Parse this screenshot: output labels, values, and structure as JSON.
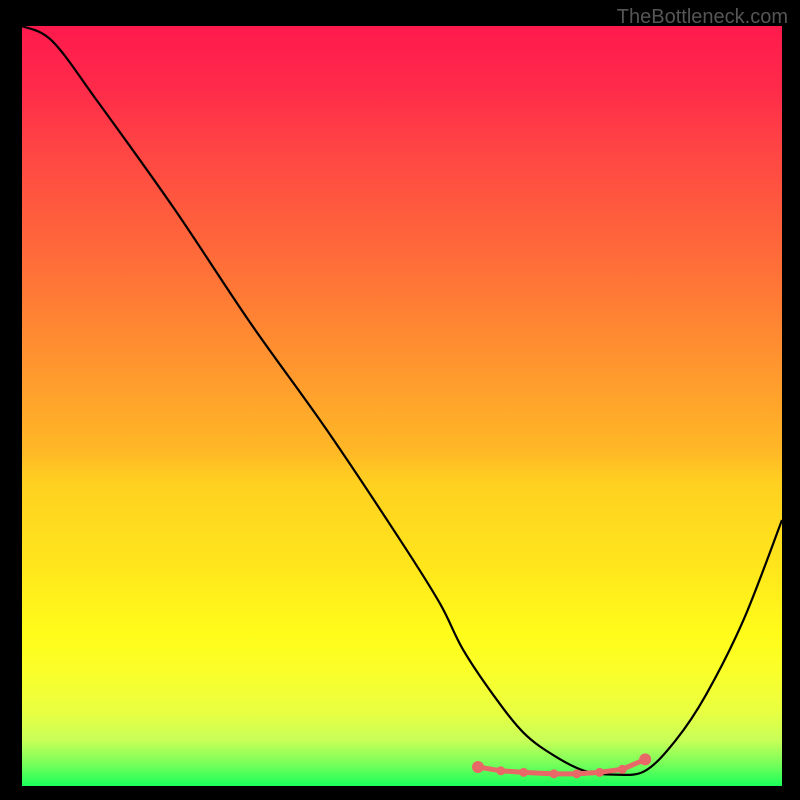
{
  "watermark": "TheBottleneck.com",
  "chart_data": {
    "type": "line",
    "title": "",
    "xlabel": "",
    "ylabel": "",
    "xlim": [
      0,
      100
    ],
    "ylim": [
      0,
      100
    ],
    "grid": false,
    "series": [
      {
        "name": "curve",
        "color": "#000000",
        "x": [
          0,
          4,
          10,
          20,
          30,
          40,
          50,
          55,
          58,
          62,
          66,
          70,
          74,
          78,
          82,
          86,
          90,
          95,
          100
        ],
        "y": [
          100,
          98,
          90,
          76,
          61,
          47,
          32,
          24,
          18,
          12,
          7,
          4,
          2,
          1.5,
          2,
          6,
          12,
          22,
          35
        ]
      },
      {
        "name": "optimal-range-markers",
        "color": "#e86868",
        "type": "scatter",
        "x": [
          60,
          63,
          66,
          70,
          73,
          76,
          79,
          82
        ],
        "y": [
          2.5,
          2,
          1.8,
          1.6,
          1.6,
          1.8,
          2.2,
          3.5
        ]
      }
    ],
    "background_gradient": {
      "top": "#ff1a4d",
      "middle": "#ffd020",
      "bottom": "#1aff5a"
    }
  }
}
